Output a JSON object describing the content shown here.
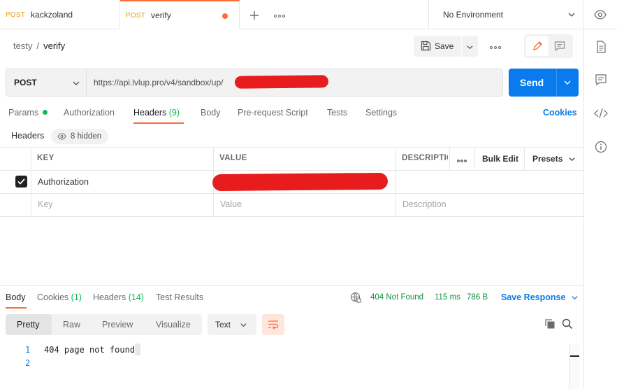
{
  "tabs": [
    {
      "method": "POST",
      "name": "kackzoland"
    },
    {
      "method": "POST",
      "name": "verify"
    }
  ],
  "environment": "No Environment",
  "breadcrumb": {
    "collection": "testy",
    "separator": "/",
    "request": "verify"
  },
  "toolbar": {
    "save_label": "Save"
  },
  "request": {
    "method": "POST",
    "url": "https://api.lvlup.pro/v4/sandbox/up/",
    "send_label": "Send"
  },
  "request_tabs": {
    "params": "Params",
    "authorization": "Authorization",
    "headers": "Headers",
    "headers_count": "(9)",
    "body": "Body",
    "pre_request": "Pre-request Script",
    "tests": "Tests",
    "settings": "Settings",
    "cookies": "Cookies"
  },
  "headers_section": {
    "label": "Headers",
    "hidden": "8 hidden"
  },
  "table": {
    "col_key": "KEY",
    "col_value": "VALUE",
    "col_desc": "DESCRIPTIO",
    "bulk_edit": "Bulk Edit",
    "presets": "Presets",
    "row_key": "Authorization",
    "placeholder_key": "Key",
    "placeholder_value": "Value",
    "placeholder_desc": "Description"
  },
  "response": {
    "tabs": {
      "body": "Body",
      "cookies": "Cookies",
      "cookies_count": "(1)",
      "headers": "Headers",
      "headers_count": "(14)",
      "tests": "Test Results"
    },
    "status": "404 Not Found",
    "time": "115 ms",
    "size": "786 B",
    "save_response": "Save Response",
    "views": {
      "pretty": "Pretty",
      "raw": "Raw",
      "preview": "Preview",
      "visualize": "Visualize"
    },
    "format": "Text",
    "lines": [
      {
        "n": "1",
        "text": "404 page not found"
      },
      {
        "n": "2",
        "text": ""
      }
    ]
  },
  "colors": {
    "accent": "#ff6c37",
    "primary": "#097bed",
    "success": "#0cbb52",
    "redaction": "#e81c1c"
  }
}
